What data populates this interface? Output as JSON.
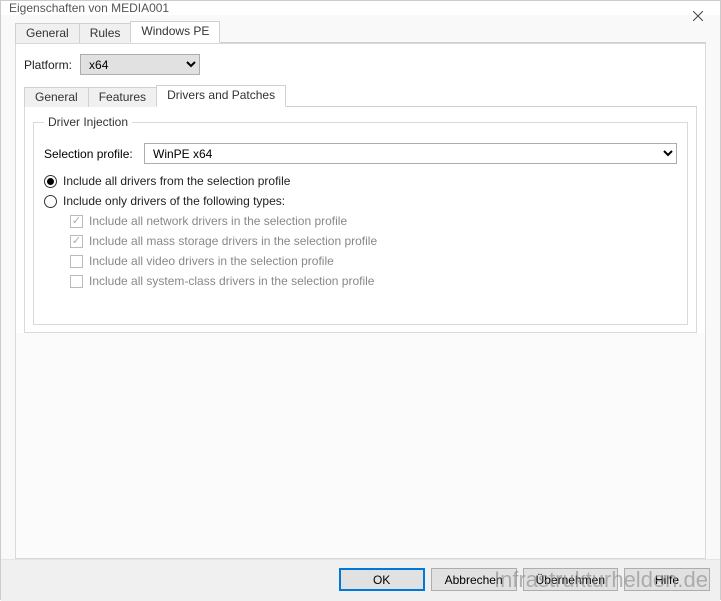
{
  "window": {
    "title": "Eigenschaften von MEDIA001"
  },
  "mainTabs": {
    "general": "General",
    "rules": "Rules",
    "windowsPE": "Windows PE"
  },
  "platform": {
    "label": "Platform:",
    "value": "x64"
  },
  "subTabs": {
    "general": "General",
    "features": "Features",
    "driversAndPatches": "Drivers and Patches"
  },
  "driverInjection": {
    "legend": "Driver Injection",
    "selectionProfileLabel": "Selection profile:",
    "selectionProfileValue": "WinPE x64",
    "radio_all": "Include all drivers from the selection profile",
    "radio_types": "Include only drivers of the following types:",
    "chk_network": "Include all network drivers in the selection profile",
    "chk_massstorage": "Include all mass storage drivers in the selection profile",
    "chk_video": "Include all video drivers in the selection profile",
    "chk_systemclass": "Include all system-class drivers in the selection profile"
  },
  "buttons": {
    "ok": "OK",
    "cancel": "Abbrechen",
    "apply": "Übernehmen",
    "help": "Hilfe"
  },
  "watermark": "Infrastrukturhelden.de"
}
